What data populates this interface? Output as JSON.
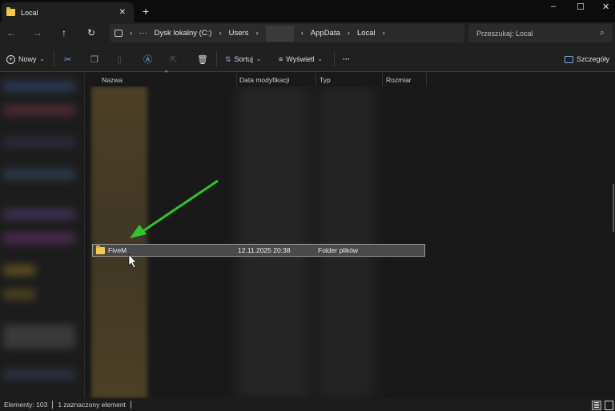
{
  "window": {
    "tab_title": "Local",
    "minimize": "–",
    "maximize": "☐",
    "close": "✕",
    "new_tab": "+",
    "tab_close": "✕"
  },
  "nav": {
    "back": "←",
    "forward": "→",
    "up": "↑",
    "refresh": "↻"
  },
  "address": {
    "more": "···",
    "segments": [
      "Dysk lokalny (C:)",
      "Users",
      "AppData",
      "Local"
    ],
    "sep": "›"
  },
  "search": {
    "placeholder": "Przeszukaj: Local",
    "icon": "⌕"
  },
  "toolbar": {
    "new": "Nowy",
    "sort": "Sortuj",
    "view": "Wyświetl",
    "more": "···",
    "details": "Szczegóły",
    "caret": "⌄"
  },
  "columns": {
    "name": "Nazwa",
    "date": "Data modyfikacji",
    "type": "Typ",
    "size": "Rozmiar"
  },
  "selected": {
    "name": "FiveM",
    "date": "12.11.2025 20:38",
    "type": "Folder plików"
  },
  "status": {
    "count": "Elementy: 103",
    "selected": "1 zaznaczony element"
  },
  "colors": {
    "accent": "#f3c84b",
    "arrow": "#2fc52f"
  }
}
